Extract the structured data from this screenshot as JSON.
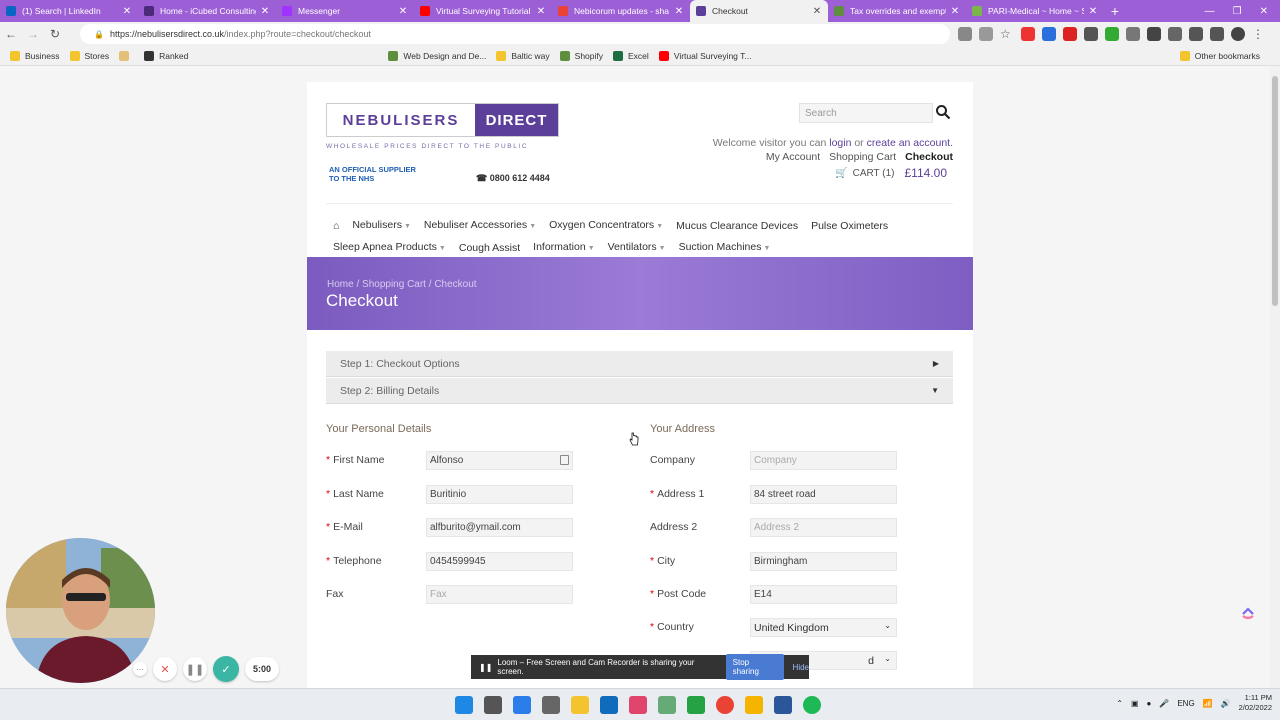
{
  "browser": {
    "tabs": [
      {
        "label": "(1) Search | LinkedIn",
        "icon": "linkedin-icon",
        "color": "#0a66c2",
        "active": false
      },
      {
        "label": "Home - iCubed Consulting",
        "icon": "icubed-icon",
        "color": "#4b2a7a",
        "active": false
      },
      {
        "label": "Messenger",
        "icon": "messenger-icon",
        "color": "#a033ff",
        "active": false
      },
      {
        "label": "Virtual Surveying Tutorial",
        "icon": "youtube-icon",
        "color": "#ff0000",
        "active": false
      },
      {
        "label": "Nebicorum updates - sha",
        "icon": "gmail-icon",
        "color": "#ea4335",
        "active": false
      },
      {
        "label": "Checkout",
        "icon": "nebulisers-icon",
        "color": "#5b3f99",
        "active": true
      },
      {
        "label": "Tax overrides and exempti",
        "icon": "shopify-icon",
        "color": "#5e8e3e",
        "active": false
      },
      {
        "label": "PARI-Medical ~ Home ~ S",
        "icon": "pari-icon",
        "color": "#7ab648",
        "active": false
      }
    ],
    "url_host": "https://nebulisersdirect.co.uk",
    "url_path": "/index.php?route=checkout/checkout",
    "bookmarks": [
      {
        "label": "Business",
        "type": "folder"
      },
      {
        "label": "Stores",
        "type": "folder"
      },
      {
        "label": "",
        "type": "page"
      },
      {
        "label": "Ranked",
        "type": "page"
      },
      {
        "label": "Web Design and De...",
        "type": "page"
      },
      {
        "label": "Baltic way",
        "type": "folder"
      },
      {
        "label": "Shopify",
        "type": "page"
      },
      {
        "label": "Excel",
        "type": "page"
      },
      {
        "label": "Virtual Surveying T...",
        "type": "page"
      }
    ],
    "other_bookmarks": "Other bookmarks"
  },
  "header": {
    "logo_left": "NEBULISERS",
    "logo_right": "DIRECT",
    "logo_tagline": "WHOLESALE PRICES DIRECT TO THE PUBLIC",
    "nhs_line1": "AN OFFICIAL SUPPLIER",
    "nhs_line2": "TO THE NHS",
    "phone": "0800 612 4484",
    "search_placeholder": "Search",
    "welcome_prefix": "Welcome visitor you can",
    "login_link": "login",
    "or_text": "or",
    "create_link": "create an account.",
    "my_account": "My Account",
    "shopping_cart": "Shopping Cart",
    "checkout": "Checkout",
    "cart_label": "CART (1)",
    "cart_price": "£114.00"
  },
  "menu": {
    "row1": [
      {
        "label": "Nebulisers",
        "dropdown": true
      },
      {
        "label": "Nebuliser Accessories",
        "dropdown": true
      },
      {
        "label": "Oxygen Concentrators",
        "dropdown": true
      },
      {
        "label": "Mucus Clearance Devices",
        "dropdown": false
      },
      {
        "label": "Pulse Oximeters",
        "dropdown": false
      }
    ],
    "row2": [
      {
        "label": "Sleep Apnea Products",
        "dropdown": true
      },
      {
        "label": "Cough Assist",
        "dropdown": false
      },
      {
        "label": "Information",
        "dropdown": true
      },
      {
        "label": "Ventilators",
        "dropdown": true
      },
      {
        "label": "Suction Machines",
        "dropdown": true
      }
    ]
  },
  "banner": {
    "crumbs": [
      "Home",
      "Shopping Cart",
      "Checkout"
    ],
    "title": "Checkout"
  },
  "steps": {
    "step1": "Step 1: Checkout Options",
    "step2": "Step 2: Billing Details"
  },
  "personal": {
    "title": "Your Personal Details",
    "fields": [
      {
        "label": "First Name",
        "required": true,
        "value": "Alfonso",
        "placeholder": ""
      },
      {
        "label": "Last Name",
        "required": true,
        "value": "Buritinio",
        "placeholder": ""
      },
      {
        "label": "E-Mail",
        "required": true,
        "value": "alfburito@ymail.com",
        "placeholder": ""
      },
      {
        "label": "Telephone",
        "required": true,
        "value": "0454599945",
        "placeholder": ""
      },
      {
        "label": "Fax",
        "required": false,
        "value": "",
        "placeholder": "Fax"
      }
    ]
  },
  "address": {
    "title": "Your Address",
    "fields": [
      {
        "label": "Company",
        "required": false,
        "value": "",
        "placeholder": "Company"
      },
      {
        "label": "Address 1",
        "required": true,
        "value": "84 street road",
        "placeholder": ""
      },
      {
        "label": "Address 2",
        "required": false,
        "value": "",
        "placeholder": "Address 2"
      },
      {
        "label": "City",
        "required": true,
        "value": "Birmingham",
        "placeholder": ""
      },
      {
        "label": "Post Code",
        "required": true,
        "value": "E14",
        "placeholder": ""
      }
    ],
    "country_label": "Country",
    "country_value": "United Kingdom",
    "region_value": "d"
  },
  "loom": {
    "timer": "5:00",
    "share_text": "Loom – Free Screen and Cam Recorder is sharing your screen.",
    "stop_label": "Stop sharing",
    "hide_label": "Hide"
  },
  "taskbar": {
    "lang": "ENG",
    "time": "1:11 PM",
    "date": "2/02/2022"
  }
}
